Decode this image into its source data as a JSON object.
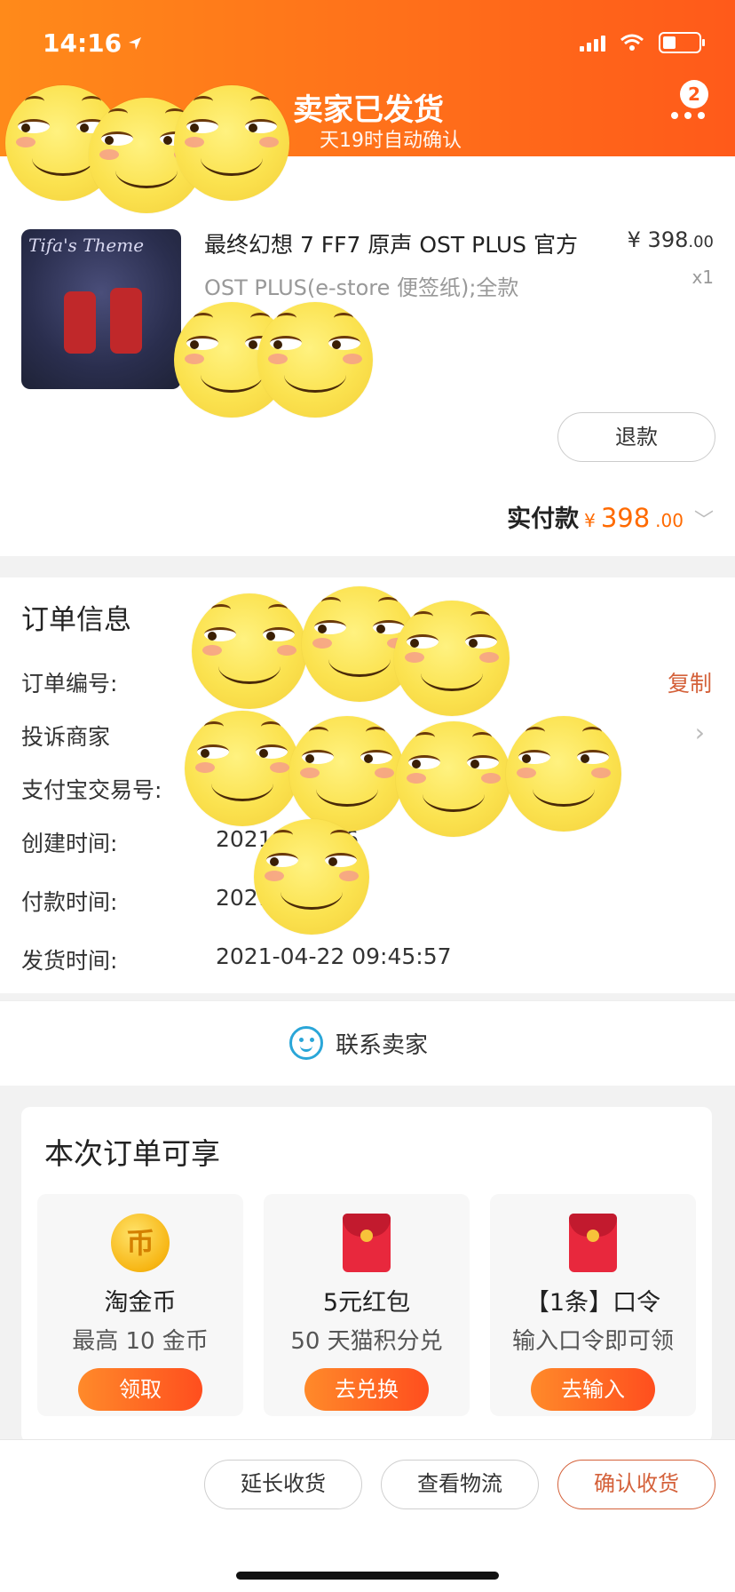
{
  "status_bar": {
    "time": "14:16"
  },
  "header": {
    "title": "卖家已发货",
    "subtitle": "天19时自动确认",
    "more_badge": "2"
  },
  "product": {
    "thumb_script": "Tifa's Theme",
    "title": "最终幻想 7 FF7 原声 OST PLUS 官方",
    "sku": "OST PLUS(e-store 便签纸);全款",
    "price_symbol": "¥",
    "price_int": "398",
    "price_dec": ".00",
    "quantity": "x1",
    "refund_button": "退款",
    "paid_label": "实付款",
    "paid_symbol": "¥",
    "paid_int": "398",
    "paid_dec": ".00"
  },
  "order_info": {
    "title": "订单信息",
    "copy": "复制",
    "rows": [
      {
        "label": "订单编号:",
        "value": ""
      },
      {
        "label": "投诉商家",
        "value": ""
      },
      {
        "label": "支付宝交易号:",
        "value": ""
      },
      {
        "label": "创建时间:",
        "value": "2021-  :02:36"
      },
      {
        "label": "付款时间:",
        "value": "2021    :02:39"
      },
      {
        "label": "发货时间:",
        "value": "2021-04-22 09:45:57"
      }
    ]
  },
  "contact": {
    "label": "联系卖家"
  },
  "benefits": {
    "title": "本次订单可享",
    "items": [
      {
        "icon": "coin-icon",
        "icon_text": "币",
        "name": "淘金币",
        "desc": "最高 10 金币",
        "button": "领取"
      },
      {
        "icon": "red-packet-icon",
        "name": "5元红包",
        "desc": "50 天猫积分兑",
        "button": "去兑换"
      },
      {
        "icon": "red-packet-icon",
        "name": "【1条】口令",
        "desc": "输入口令即可领",
        "button": "去输入"
      }
    ]
  },
  "bottom_bar": {
    "extend": "延长收货",
    "logistics": "查看物流",
    "confirm": "确认收货"
  }
}
